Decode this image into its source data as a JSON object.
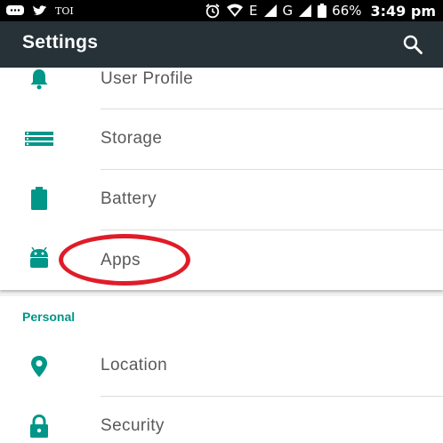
{
  "status_bar": {
    "carrier_text": "TOI",
    "network_e": "E",
    "network_g": "G",
    "battery_percent": "66%",
    "time": "3:49 pm",
    "icons": [
      "message-icon",
      "twitter-icon",
      "alarm-icon",
      "wifi-icon",
      "signal-icon",
      "signal-icon",
      "battery-icon"
    ]
  },
  "toolbar": {
    "title": "Settings",
    "search_icon": "search-icon"
  },
  "device_section": {
    "items": [
      {
        "label": "User Profile",
        "icon": "bell-icon"
      },
      {
        "label": "Storage",
        "icon": "storage-icon"
      },
      {
        "label": "Battery",
        "icon": "battery-icon"
      },
      {
        "label": "Apps",
        "icon": "android-icon",
        "highlighted": true
      }
    ]
  },
  "personal_section": {
    "header": "Personal",
    "items": [
      {
        "label": "Location",
        "icon": "location-icon"
      },
      {
        "label": "Security",
        "icon": "lock-icon"
      }
    ]
  },
  "colors": {
    "toolbar_bg": "#263238",
    "accent": "#009688",
    "highlight": "#e01c28",
    "label_text": "#595959"
  }
}
